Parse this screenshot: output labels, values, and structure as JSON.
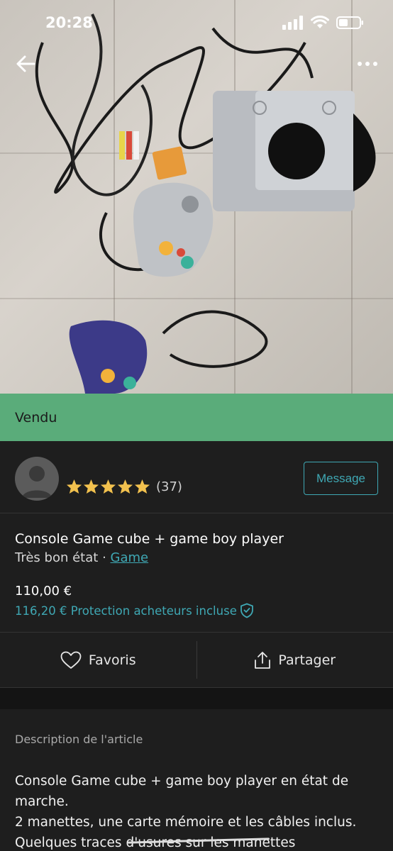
{
  "status_bar": {
    "time": "20:28"
  },
  "nav": {
    "back_icon": "arrow-left-icon",
    "more_icon": "more-horizontal-icon"
  },
  "listing": {
    "status_label": "Vendu",
    "title": "Console Game cube + game boy player",
    "condition": "Très bon état",
    "separator": "·",
    "category": "Game",
    "price": "110,00 €",
    "protection_price": "116,20 € Protection acheteurs incluse"
  },
  "seller": {
    "rating_stars": 5,
    "rating_count": "(37)",
    "message_label": "Message"
  },
  "actions": {
    "favorite_label": "Favoris",
    "share_label": "Partager"
  },
  "description": {
    "heading": "Description de l'article",
    "lines": [
      "Console Game cube + game boy player en état de",
      "marche.",
      "2 manettes, une carte mémoire  et les câbles inclus.",
      "Quelques traces d'usures sur les manettes"
    ]
  },
  "colors": {
    "accent": "#3fa8b4",
    "sold_banner": "#5aac7a",
    "star": "#f2c14e",
    "background": "#1e1e1e"
  }
}
